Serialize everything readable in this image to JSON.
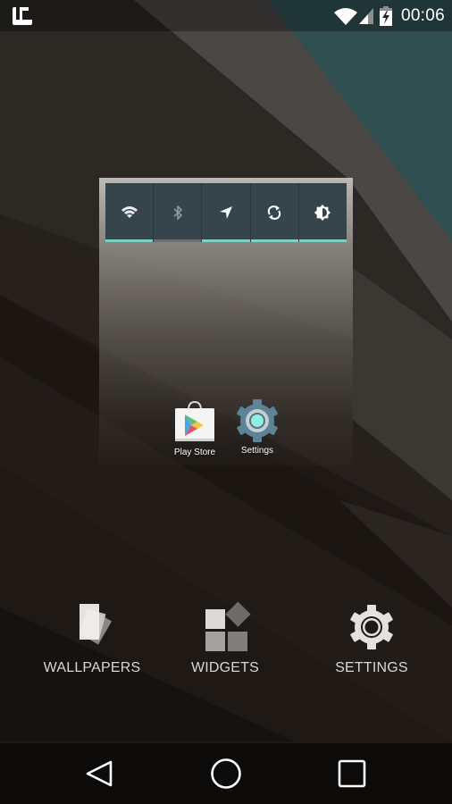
{
  "status_bar": {
    "launcher_icon": "launcher-notification-icon",
    "wifi_icon": "wifi-icon",
    "signal_icon": "cellular-signal-icon",
    "battery_icon": "battery-charging-icon",
    "time": "00:06"
  },
  "quick_settings_widget": {
    "tiles": [
      {
        "name": "wifi",
        "icon": "wifi-icon",
        "state": "on"
      },
      {
        "name": "bluetooth",
        "icon": "bluetooth-icon",
        "state": "off"
      },
      {
        "name": "location",
        "icon": "location-arrow-icon",
        "state": "on"
      },
      {
        "name": "sync",
        "icon": "sync-icon",
        "state": "on"
      },
      {
        "name": "brightness",
        "icon": "brightness-auto-icon",
        "state": "on"
      }
    ],
    "colors": {
      "background": "#36444b",
      "active_indicator": "#7ecfc4",
      "inactive_indicator": "#6a6f72"
    }
  },
  "home_apps": [
    {
      "label": "Play Store",
      "icon": "play-store-icon"
    },
    {
      "label": "Settings",
      "icon": "settings-gear-icon"
    }
  ],
  "edit_options": [
    {
      "label": "WALLPAPERS",
      "icon": "wallpapers-icon"
    },
    {
      "label": "WIDGETS",
      "icon": "widgets-icon"
    },
    {
      "label": "SETTINGS",
      "icon": "settings-icon"
    }
  ],
  "navigation": {
    "back": "back-icon",
    "home": "home-icon",
    "recents": "recents-icon"
  },
  "colors": {
    "teal_wallpaper": "#2d4f4f",
    "accent": "#7ecfc4"
  }
}
